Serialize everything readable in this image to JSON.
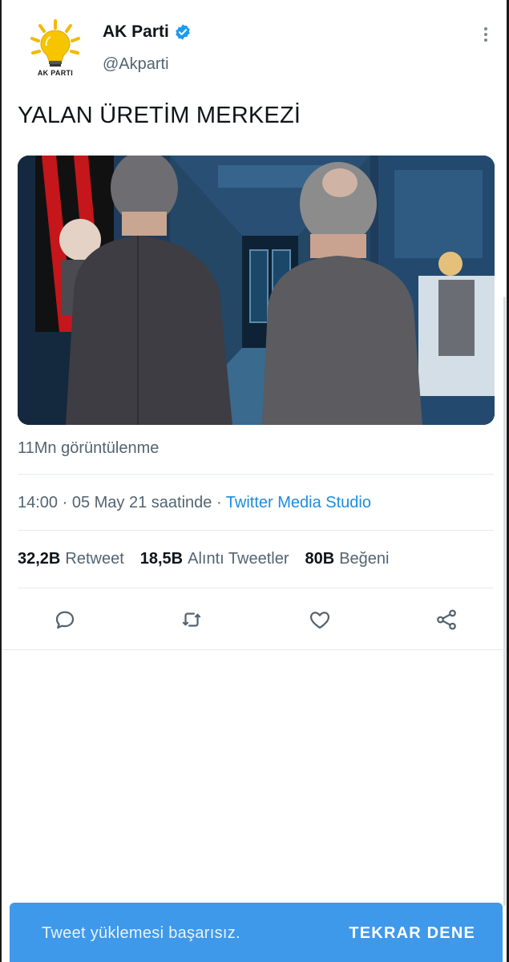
{
  "tweet": {
    "avatar_caption": "AK PARTI",
    "display_name": "AK Parti",
    "handle": "@Akparti",
    "text": "YALAN ÜRETİM MERKEZİ",
    "views": "11Mn görüntülenme",
    "time": "14:00 · 05 May 21 saatinde · ",
    "source": "Twitter Media Studio",
    "stats": [
      {
        "value": "32,2B",
        "label": "Retweet"
      },
      {
        "value": "18,5B",
        "label": "Alıntı Tweetler"
      },
      {
        "value": "80B",
        "label": "Beğeni"
      }
    ]
  },
  "icons": {
    "verified": "verified-badge-icon",
    "more": "more-vertical-icon",
    "reply": "reply-icon",
    "retweet": "retweet-icon",
    "like": "heart-icon",
    "share": "share-icon"
  },
  "colors": {
    "accent": "#1d8ce0",
    "toast": "#3f99ea",
    "secondary_text": "#536471"
  },
  "toast": {
    "message": "Tweet yüklemesi başarısız.",
    "action": "TEKRAR DENE"
  }
}
